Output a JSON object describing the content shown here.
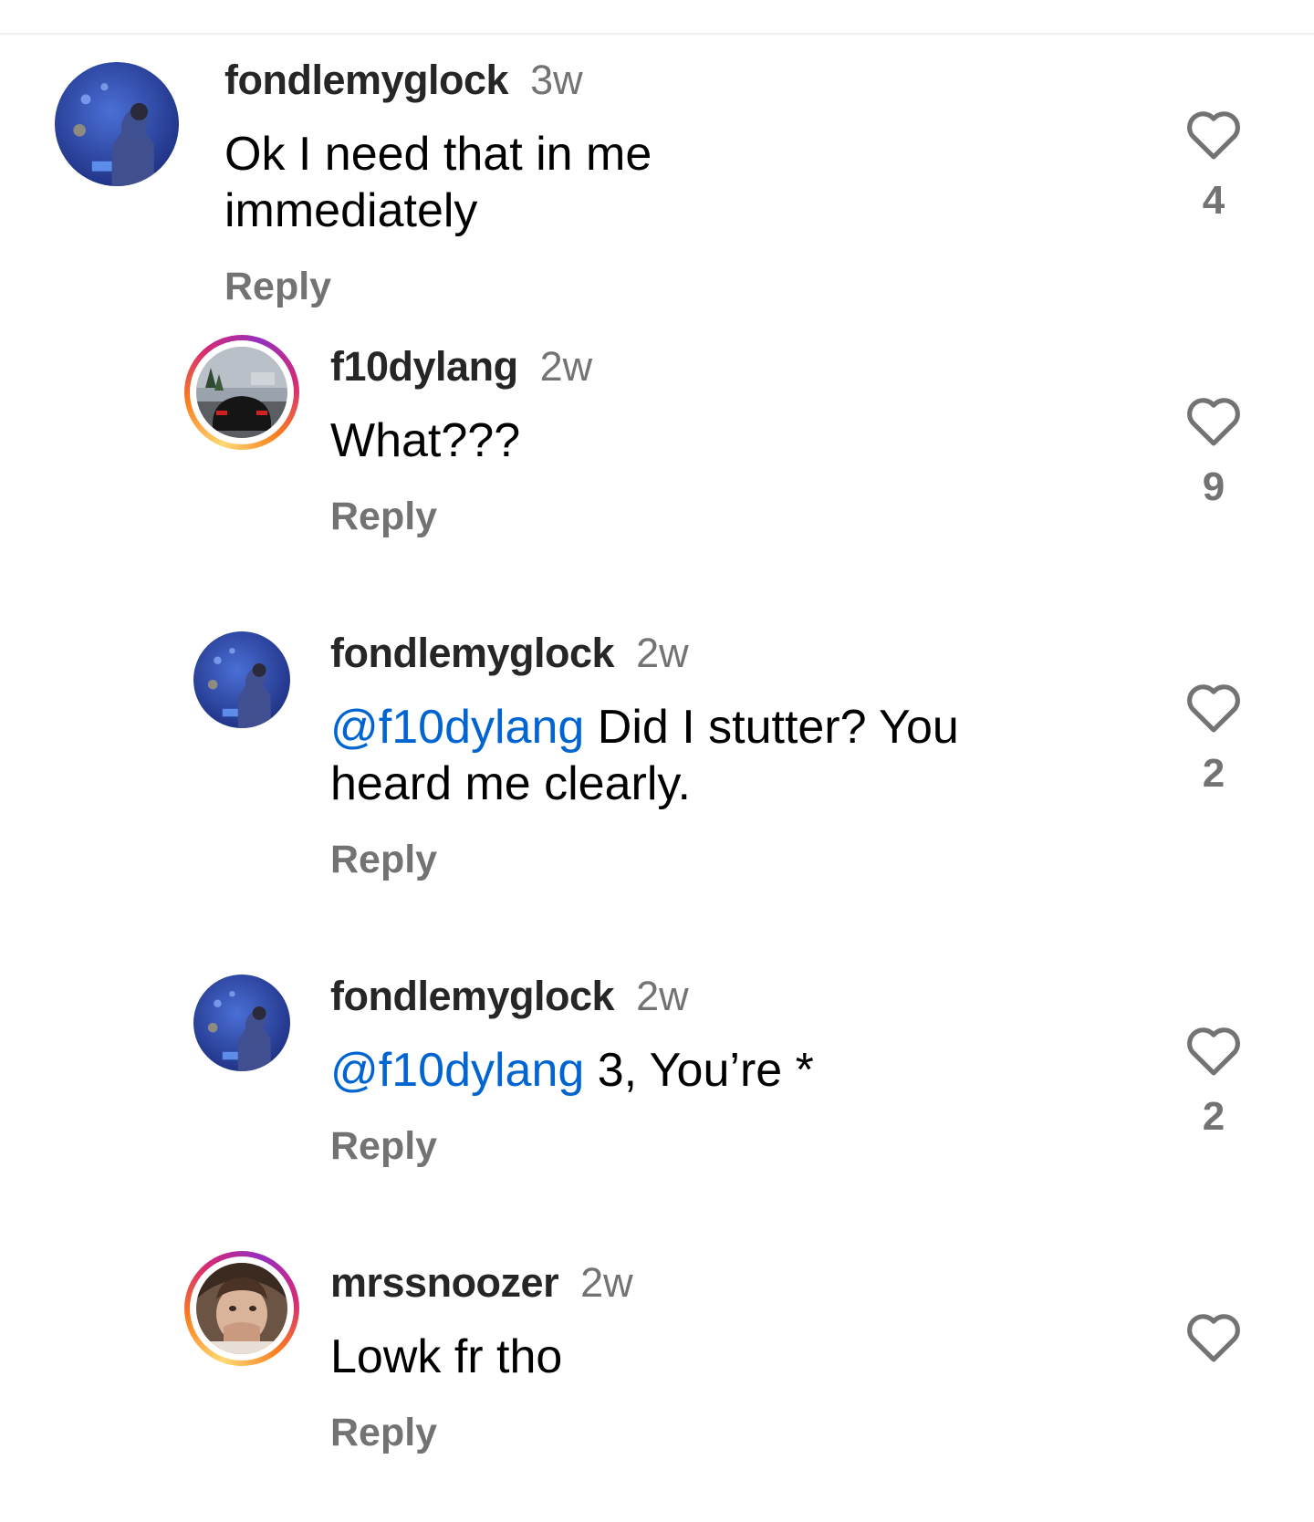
{
  "comments": [
    {
      "username": "fondlemyglock",
      "time": "3w",
      "mention": "",
      "text": "Ok I need that in me immediately",
      "reply_label": "Reply",
      "likes": "4",
      "avatar_icon": "aquarium-photo-avatar",
      "has_story_ring": false
    },
    {
      "username": "f10dylang",
      "time": "2w",
      "mention": "",
      "text": "What???",
      "reply_label": "Reply",
      "likes": "9",
      "avatar_icon": "car-photo-avatar",
      "has_story_ring": true
    },
    {
      "username": "fondlemyglock",
      "time": "2w",
      "mention": "@f10dylang",
      "text": " Did I stutter? You heard me clearly.",
      "reply_label": "Reply",
      "likes": "2",
      "avatar_icon": "aquarium-photo-avatar",
      "has_story_ring": false
    },
    {
      "username": "fondlemyglock",
      "time": "2w",
      "mention": "@f10dylang",
      "text": " 3, You’re *",
      "reply_label": "Reply",
      "likes": "2",
      "avatar_icon": "aquarium-photo-avatar",
      "has_story_ring": false
    },
    {
      "username": "mrssnoozer",
      "time": "2w",
      "mention": "",
      "text": "Lowk fr tho",
      "reply_label": "Reply",
      "likes": "",
      "avatar_icon": "selfie-photo-avatar",
      "has_story_ring": true
    }
  ],
  "colors": {
    "mention": "#0064d1",
    "muted_text": "#737373",
    "username": "#262626",
    "story_ring": [
      "#feda75",
      "#fa7e1e",
      "#d62976",
      "#962fbf"
    ]
  },
  "icons": {
    "like": "heart-outline-icon"
  }
}
